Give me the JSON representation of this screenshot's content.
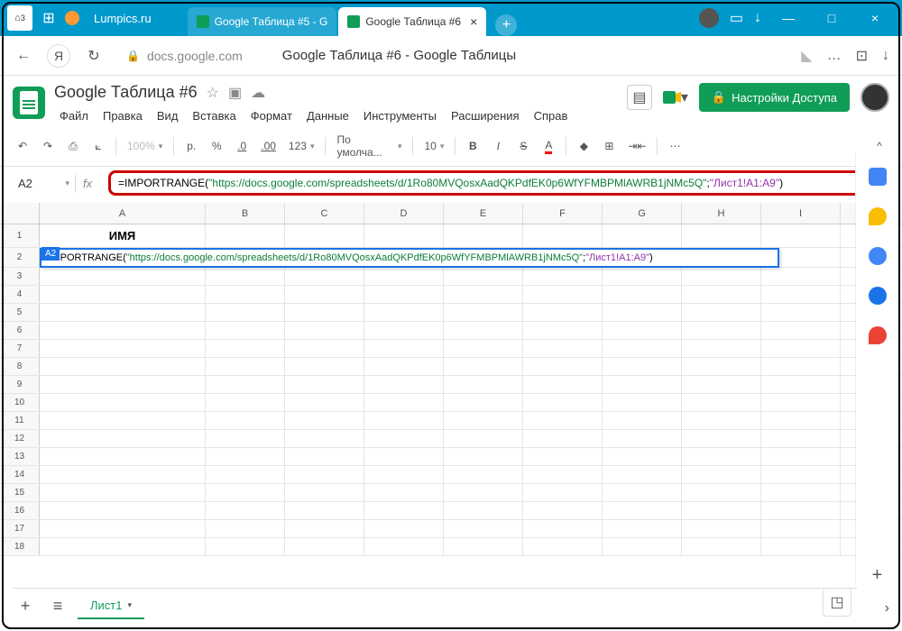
{
  "window": {
    "home_badge": "3",
    "site": "Lumpics.ru",
    "tabs": [
      {
        "label": "Google Таблица #5 - G",
        "active": false
      },
      {
        "label": "Google Таблица #6",
        "active": true
      }
    ]
  },
  "browser": {
    "url": "docs.google.com",
    "page_title": "Google Таблица #6 - Google Таблицы",
    "more": "…"
  },
  "doc": {
    "title": "Google Таблица #6",
    "menus": [
      "Файл",
      "Правка",
      "Вид",
      "Вставка",
      "Формат",
      "Данные",
      "Инструменты",
      "Расширения",
      "Справ"
    ],
    "share": "Настройки Доступа"
  },
  "toolbar": {
    "zoom": "100%",
    "currency": "р.",
    "percent": "%",
    "dec_dec": ".0",
    "dec_inc": ".00",
    "num_fmt": "123",
    "font": "По умолча...",
    "font_size": "10",
    "bold": "B",
    "italic": "I",
    "strike": "S",
    "text_color": "A"
  },
  "formula": {
    "cell_ref": "A2",
    "fx": "fx",
    "fn": "=IMPORTRANGE",
    "url": "\"https://docs.google.com/spreadsheets/d/1Ro80MVQosxAadQKPdfEK0p6WfYFMBPMlAWRB1jNMc5Q\"",
    "range": "\"Лист1!A1:A9\"",
    "semi": "; "
  },
  "grid": {
    "columns": [
      "A",
      "B",
      "C",
      "D",
      "E",
      "F",
      "G",
      "H",
      "I"
    ],
    "header_cell": "ИМЯ",
    "a2_badge": "A2",
    "row_count": 18,
    "edit_fn": "=IMPORTRANGE(",
    "edit_url": "\"https://docs.google.com/spreadsheets/d/1Ro80MVQosxAadQKPdfEK0p6WfYFMBPMlAWRB1jNMc5Q\"",
    "edit_semi": "; ",
    "edit_range": "\"Лист1!A1:A9\"",
    "edit_close": ")"
  },
  "sheets": {
    "active": "Лист1",
    "add": "+",
    "menu": "≡"
  },
  "side_colors": [
    "#4285f4",
    "#fbbc04",
    "#34a853",
    "#0f9d58",
    "#ea4335"
  ]
}
